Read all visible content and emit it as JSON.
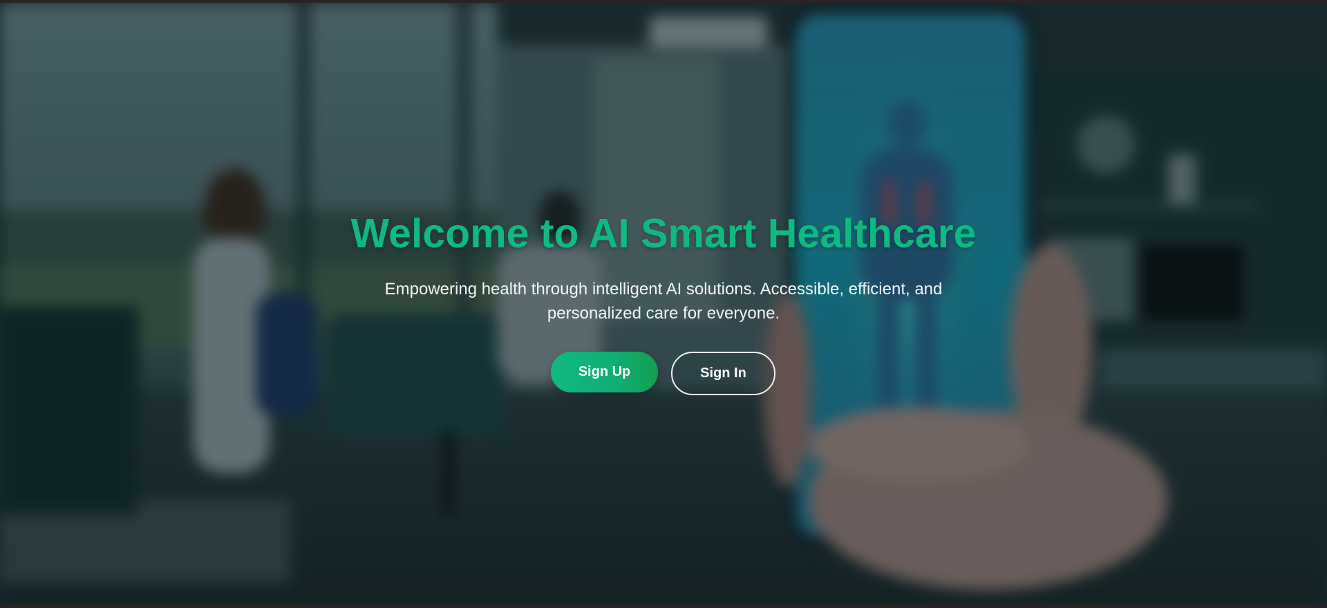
{
  "hero": {
    "title": "Welcome to AI Smart Healthcare",
    "subtitle": "Empowering health through intelligent AI solutions. Accessible, efficient, and personalized care for everyone.",
    "background_image": "blurred-hospital-with-phone-body-scan-image"
  },
  "actions": {
    "signup_label": "Sign Up",
    "signin_label": "Sign In"
  },
  "colors": {
    "accent": "#10b981",
    "text": "#f3f6f6",
    "page_frame": "#2a2323"
  }
}
